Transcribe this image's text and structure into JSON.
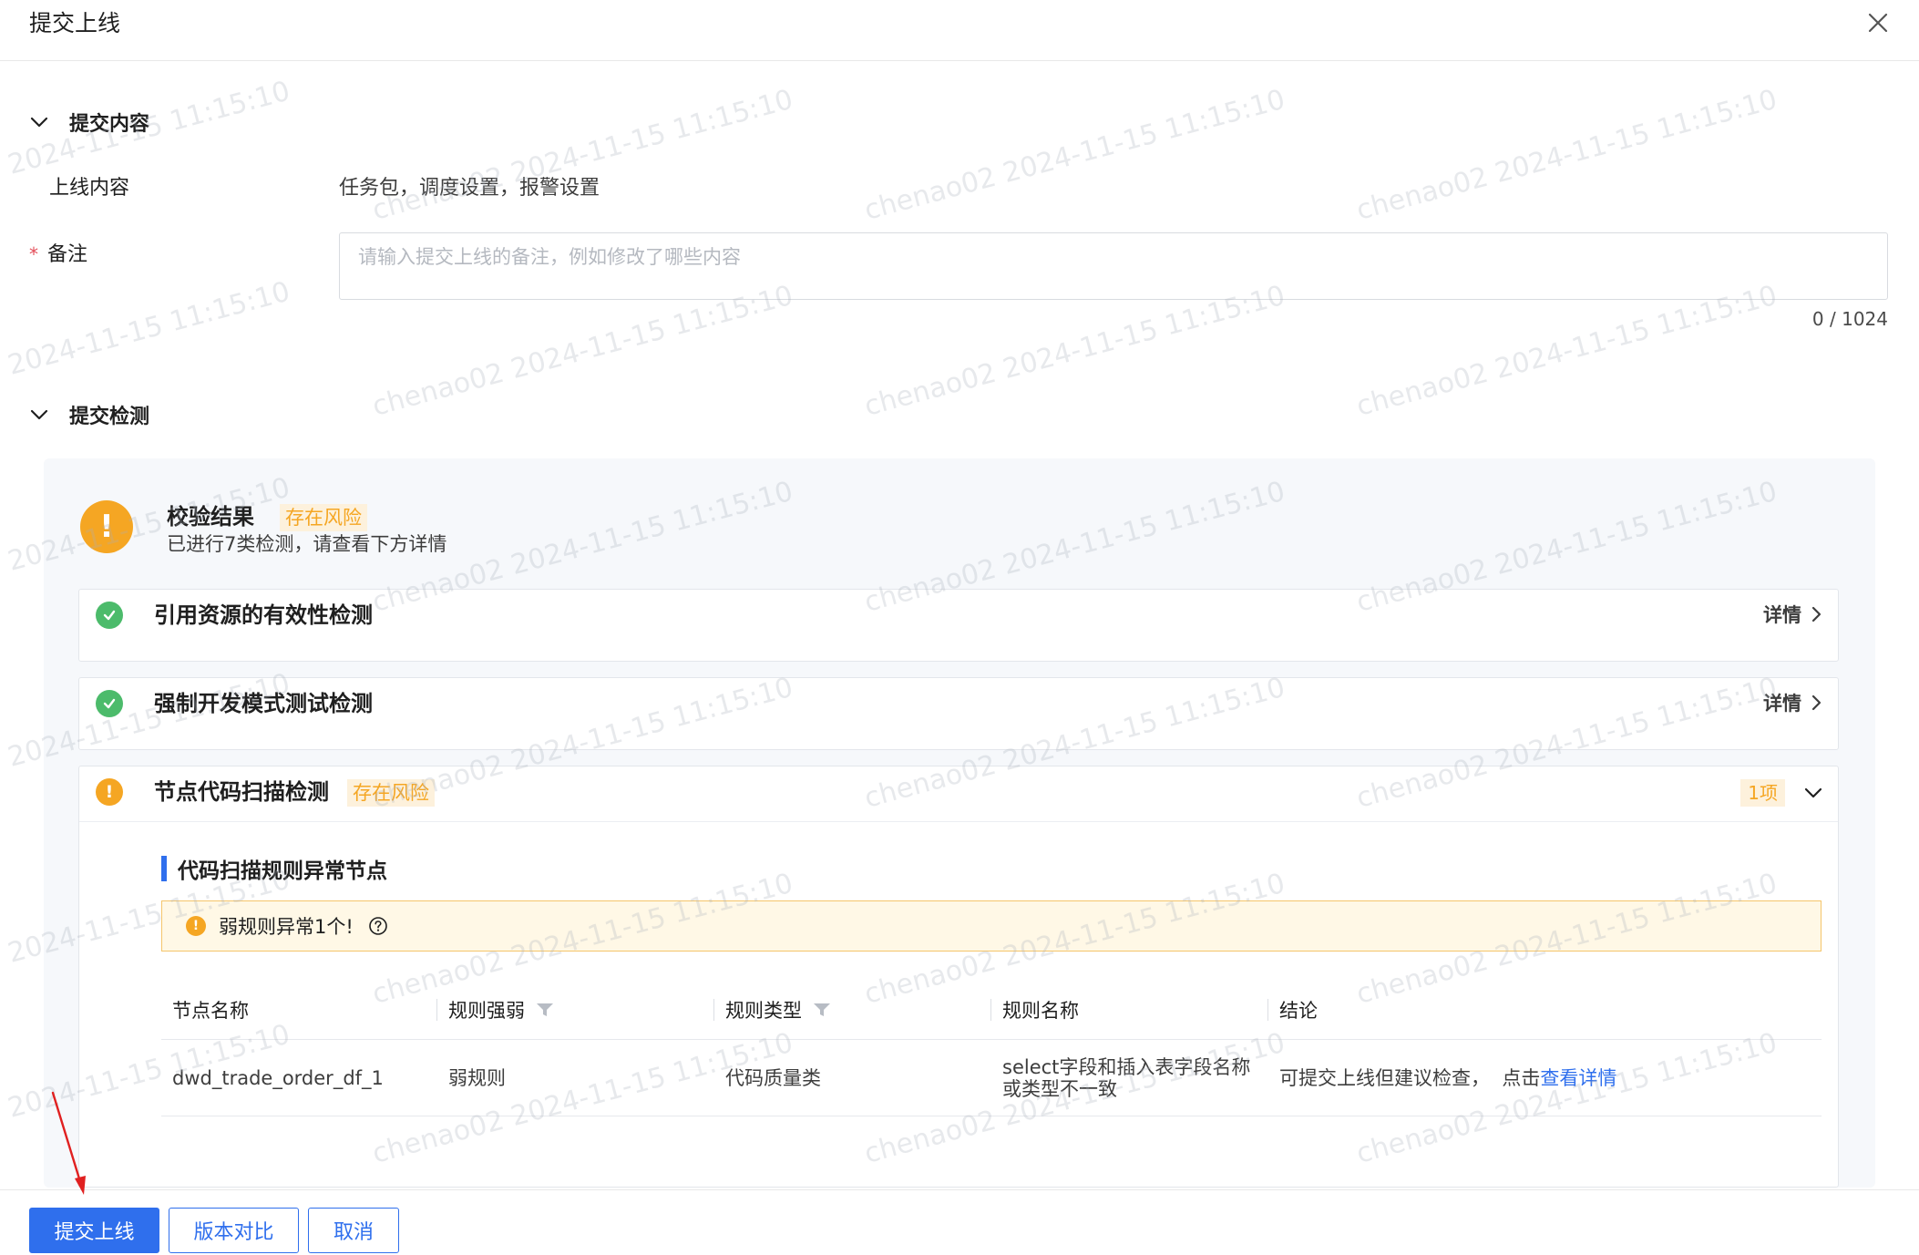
{
  "dialog": {
    "title": "提交上线"
  },
  "submit_content": {
    "section_title": "提交内容",
    "online_content_label": "上线内容",
    "online_content_value": "任务包，调度设置，报警设置",
    "remark_label": "备注",
    "remark_required_mark": "*",
    "remark_placeholder": "请输入提交上线的备注，例如修改了哪些内容",
    "remark_value": "",
    "remark_counter": "0 / 1024"
  },
  "submit_check": {
    "section_title": "提交检测",
    "result_title": "校验结果",
    "result_tag": "存在风险",
    "result_subtitle": "已进行7类检测，请查看下方详情",
    "checks": [
      {
        "title": "引用资源的有效性检测",
        "status": "pass",
        "link_label": "详情"
      },
      {
        "title": "强制开发模式测试检测",
        "status": "pass",
        "link_label": "详情"
      },
      {
        "title": "节点代码扫描检测",
        "status": "risk",
        "tag": "存在风险",
        "count_label": "1项"
      }
    ],
    "code_scan": {
      "subtitle": "代码扫描规则异常节点",
      "alert_text": "弱规则异常1个!",
      "columns": [
        "节点名称",
        "规则强弱",
        "规则类型",
        "规则名称",
        "结论"
      ],
      "rows": [
        {
          "node_name": "dwd_trade_order_df_1",
          "rule_strength": "弱规则",
          "rule_type": "代码质量类",
          "rule_name_line1": "select字段和插入表字段名称",
          "rule_name_line2": "或类型不一致",
          "conclusion": "可提交上线但建议检查，  点击",
          "conclusion_link": "查看详情"
        }
      ]
    }
  },
  "footer": {
    "submit_label": "提交上线",
    "compare_label": "版本对比",
    "cancel_label": "取消"
  },
  "watermark": {
    "text_full": "chenao02 2024-11-15 11:15:10",
    "text_date": "2024-11-15 11:15:10"
  },
  "colors": {
    "primary": "#2f6fed",
    "warning": "#f5a623",
    "success": "#4cbb6b",
    "danger": "#e34d59"
  }
}
